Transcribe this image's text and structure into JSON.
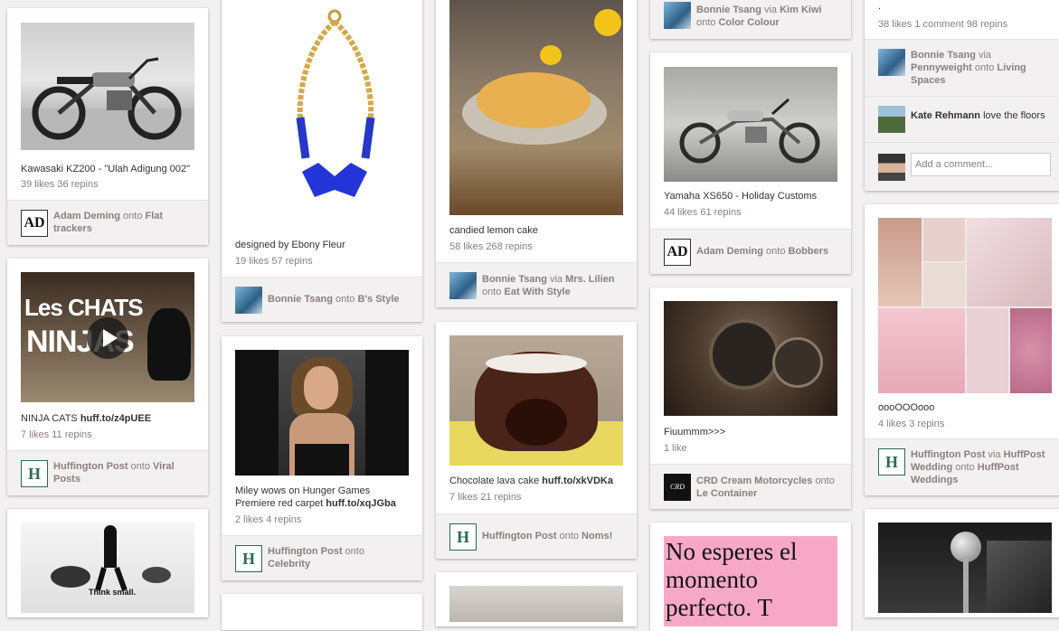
{
  "pins": {
    "kawasaki": {
      "description": "Kawasaki KZ200 - \"Ulah Adigung 002\"",
      "stats": "39 likes  36 repins",
      "user": "Adam Deming",
      "onto": "onto",
      "board": "Flat trackers",
      "board_line2": "trackers",
      "board_line1": "Flat",
      "avatar_text": "AD"
    },
    "ninja_cats": {
      "overlay_line1": "Les CHATS",
      "overlay_line2": "NINJAS",
      "description": "NINJA CATS",
      "link": "huff.to/z4pUEE",
      "stats": "7 likes  11 repins",
      "user": "Huffington Post",
      "onto": "onto",
      "board_line1": "Viral",
      "board_line2": "Posts",
      "avatar_text": "H"
    },
    "think_small": {
      "overlay": "Think small."
    },
    "necklace": {
      "description": "designed by Ebony Fleur",
      "stats": "19 likes  57 repins",
      "user": "Bonnie Tsang",
      "onto": "onto",
      "board": "B's Style"
    },
    "miley": {
      "description_line1": "Miley wows on Hunger Games",
      "description_line2": "Premiere red carpet",
      "link": "huff.to/xqJGba",
      "stats": "2 likes  4 repins",
      "user": "Huffington Post",
      "onto": "onto",
      "board": "Celebrity",
      "avatar_text": "H"
    },
    "lemon_cake": {
      "description": "candied lemon cake",
      "stats": "58 likes  268 repins",
      "user": "Bonnie Tsang",
      "via": "via",
      "via_user": "Mrs. Lilien",
      "onto": "onto",
      "board": "Eat With Style"
    },
    "lava_cake": {
      "description": "Chocolate lava cake",
      "link": "huff.to/xkVDKa",
      "stats": "7 likes  21 repins",
      "user": "Huffington Post",
      "onto": "onto",
      "board": "Noms!",
      "avatar_text": "H"
    },
    "color_colour": {
      "user": "Bonnie Tsang",
      "via": "via",
      "via_user": "Kim Kiwi",
      "onto": "onto",
      "board": "Color Colour"
    },
    "yamaha": {
      "description": "Yamaha XS650 - Holiday Customs",
      "stats": "44 likes  61 repins",
      "user": "Adam Deming",
      "onto": "onto",
      "board": "Bobbers",
      "avatar_text": "AD"
    },
    "fiuummm": {
      "description": "Fiuummm>>>",
      "stats": "1 like",
      "user": "CRD Cream Motorcycles",
      "onto": "onto",
      "board": "Le Container",
      "avatar_text": "CRD"
    },
    "no_esperes": {
      "text_line1": "No esperes el",
      "text_line2": "momento",
      "text_line3": "perfecto. T"
    },
    "living_spaces": {
      "top_text": ".",
      "stats": "38 likes  1 comment  98 repins",
      "user": "Bonnie Tsang",
      "via": "via",
      "via_user": "Pennyweight",
      "onto": "onto",
      "board": "Living Spaces",
      "board_line1": "Living",
      "board_line2": "Spaces",
      "comment_user": "Kate Rehmann",
      "comment_text": "love the floors",
      "comment_placeholder": "Add a comment..."
    },
    "wedding": {
      "description": "oooOOOooo",
      "stats": "4 likes  3 repins",
      "user": "Huffington Post",
      "via": "via",
      "via_user": "HuffPost",
      "via_user2": "Wedding",
      "onto": "onto",
      "board": "HuffPost",
      "board2": "Weddings",
      "avatar_text": "H"
    }
  },
  "colors": {
    "background": "#f2f0f0",
    "attribution_bg": "#f2f0f0",
    "muted_text": "#8c7e7e",
    "huffington_green": "#2b6a58",
    "pink_card": "#f7a8c7"
  }
}
